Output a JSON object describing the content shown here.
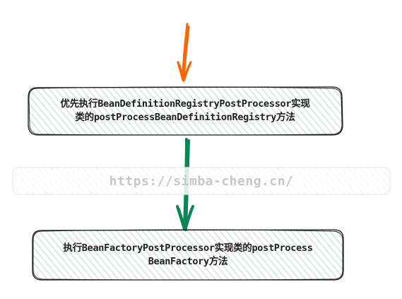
{
  "diagram": {
    "nodes": [
      {
        "id": "registry-step",
        "lines": [
          "优先执行BeanDefinitionRegistryPostProcessor实现",
          "类的postProcessBeanDefinitionRegistry方法"
        ]
      },
      {
        "id": "factory-step",
        "lines": [
          "执行BeanFactoryPostProcessor实现类的postProcess",
          "BeanFactory方法"
        ]
      }
    ],
    "edges": [
      {
        "from": "start",
        "to": "registry-step"
      },
      {
        "from": "registry-step",
        "to": "factory-step"
      }
    ],
    "watermark": "https://simba-cheng.cn/"
  },
  "colors": {
    "box_fill": "#b2f2bb",
    "box_stroke": "#1e1e1e",
    "entry_arrow": "#f76707",
    "flow_arrow": "#0c8554",
    "watermark_fill": "#d3f9d8",
    "watermark_stroke": "#e9ecef",
    "text": "#1e1e1e"
  }
}
